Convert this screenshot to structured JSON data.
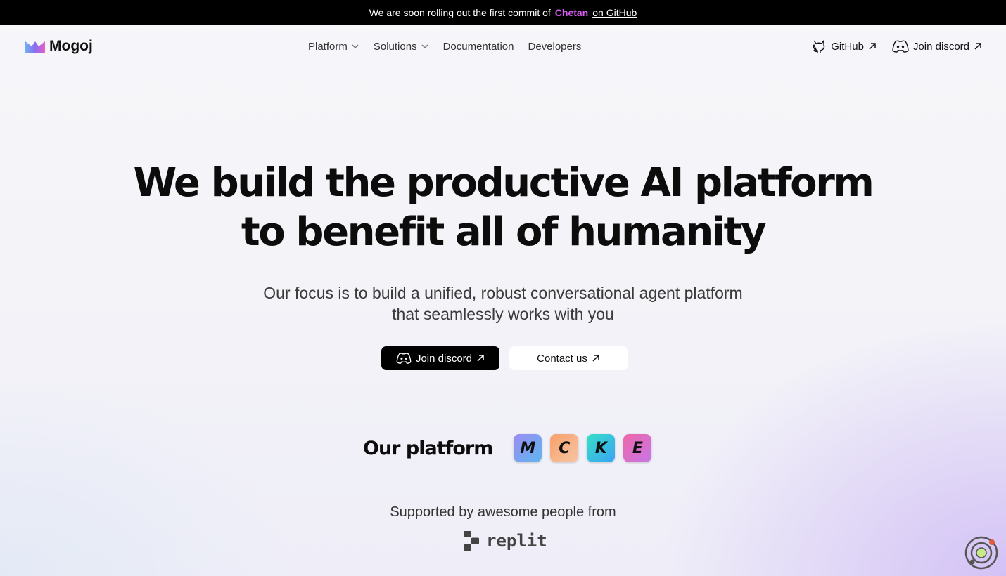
{
  "banner": {
    "text": "We are soon rolling out the first commit of",
    "highlight": "Chetan",
    "link": "on GitHub"
  },
  "header": {
    "brand": "Mogoj",
    "nav": [
      {
        "label": "Platform",
        "dropdown": true
      },
      {
        "label": "Solutions",
        "dropdown": true
      },
      {
        "label": "Documentation",
        "dropdown": false
      },
      {
        "label": "Developers",
        "dropdown": false
      }
    ],
    "github_label": "GitHub",
    "discord_label": "Join discord"
  },
  "hero": {
    "title_line1": "We build the productive AI platform",
    "title_line2": "to benefit all of humanity",
    "subtitle_line1": "Our focus is to build a unified, robust conversational agent platform",
    "subtitle_line2": "that seamlessly works with you",
    "primary_cta": "Join discord",
    "secondary_cta": "Contact us"
  },
  "platform": {
    "title": "Our platform",
    "tiles": [
      {
        "letter": "M",
        "from": "#9b8cf2",
        "to": "#5fb6f0"
      },
      {
        "letter": "C",
        "from": "#f8a06a",
        "to": "#f6c6a4"
      },
      {
        "letter": "K",
        "from": "#36e0c6",
        "to": "#3aa3f5"
      },
      {
        "letter": "E",
        "from": "#f067a6",
        "to": "#c676e8"
      }
    ]
  },
  "supported": {
    "text": "Supported by awesome people from",
    "partner": "replit"
  },
  "colors": {
    "banner_bg": "#000000",
    "highlight": "#d85cf0",
    "button_dark": "#000000"
  }
}
